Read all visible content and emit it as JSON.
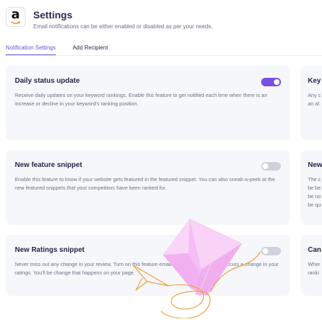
{
  "header": {
    "logo_letter": "a",
    "title": "Settings",
    "subtitle": "Email notifications can be either enabled or disabled as per your needs."
  },
  "tabs": [
    {
      "label": "Notification Settings",
      "active": true
    },
    {
      "label": "Add Recipient",
      "active": false
    }
  ],
  "cards": [
    {
      "title": "Daily status update",
      "description": "Receive daily updates on your keyword rankings. Enable this feature to get notified each time when there is an increase or decline in your keyword's ranking position.",
      "enabled": true
    },
    {
      "title": "New feature snippet",
      "description": "Enable this feature to know if your website gets featured in the featured snippet. You can also sneak-a-peek at the new featured snippets that your competitors have been ranked for.",
      "enabled": false
    },
    {
      "title": "New Ratings snippet",
      "description": "Never miss out any change in your review. Turn on this feature email each time when there occurs a change in your ratings. You'll be change that happens on your page.",
      "enabled": false
    }
  ],
  "side_cards": [
    {
      "title": "Key",
      "lines": [
        "Any c",
        "an al"
      ]
    },
    {
      "title": "New",
      "lines": [
        "The c",
        "be be",
        "be no",
        "be qu"
      ]
    },
    {
      "title": "Can",
      "lines": [
        "Wher",
        "ranki"
      ]
    }
  ],
  "colors": {
    "accent": "#7b4fe0",
    "envelope": "#f6c4f6",
    "doodle": "#f0a13a"
  },
  "icons": [
    "amazon-logo-icon",
    "envelope-illustration-icon",
    "paper-plane-doodle-icon"
  ]
}
